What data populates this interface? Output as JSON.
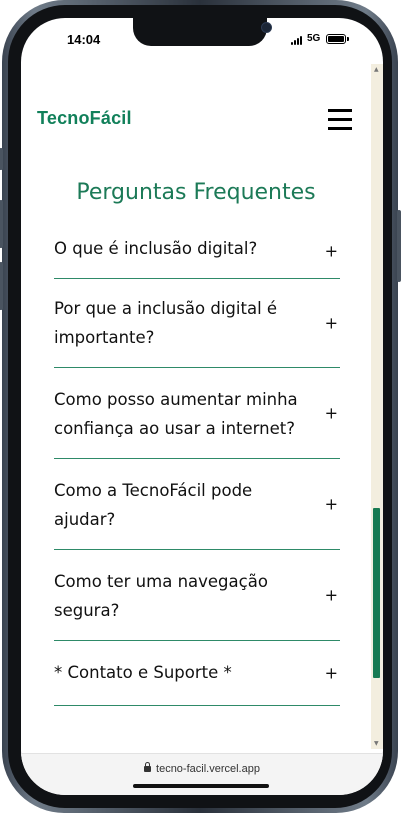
{
  "status_bar": {
    "time": "14:04",
    "network": "5G"
  },
  "header": {
    "brand": "TecnoFácil",
    "menu_icon": "hamburger-menu-icon"
  },
  "faq": {
    "title": "Perguntas Frequentes",
    "toggle_symbol": "+",
    "items": [
      {
        "question": "O que é inclusão digital?"
      },
      {
        "question": "Por que a inclusão digital é importante?"
      },
      {
        "question": "Como posso aumentar minha confiança ao usar a internet?"
      },
      {
        "question": "Como a TecnoFácil pode ajudar?"
      },
      {
        "question": "Como ter uma navegação segura?"
      },
      {
        "question": "* Contato e Suporte *"
      }
    ]
  },
  "browser": {
    "url": "tecno-facil.vercel.app",
    "lock_icon": "lock-icon"
  },
  "colors": {
    "brand": "#11805a",
    "title": "#1c7a57",
    "divider": "#2e8a68",
    "scroll_thumb": "#187a52",
    "scroll_track": "#f3eedf"
  }
}
